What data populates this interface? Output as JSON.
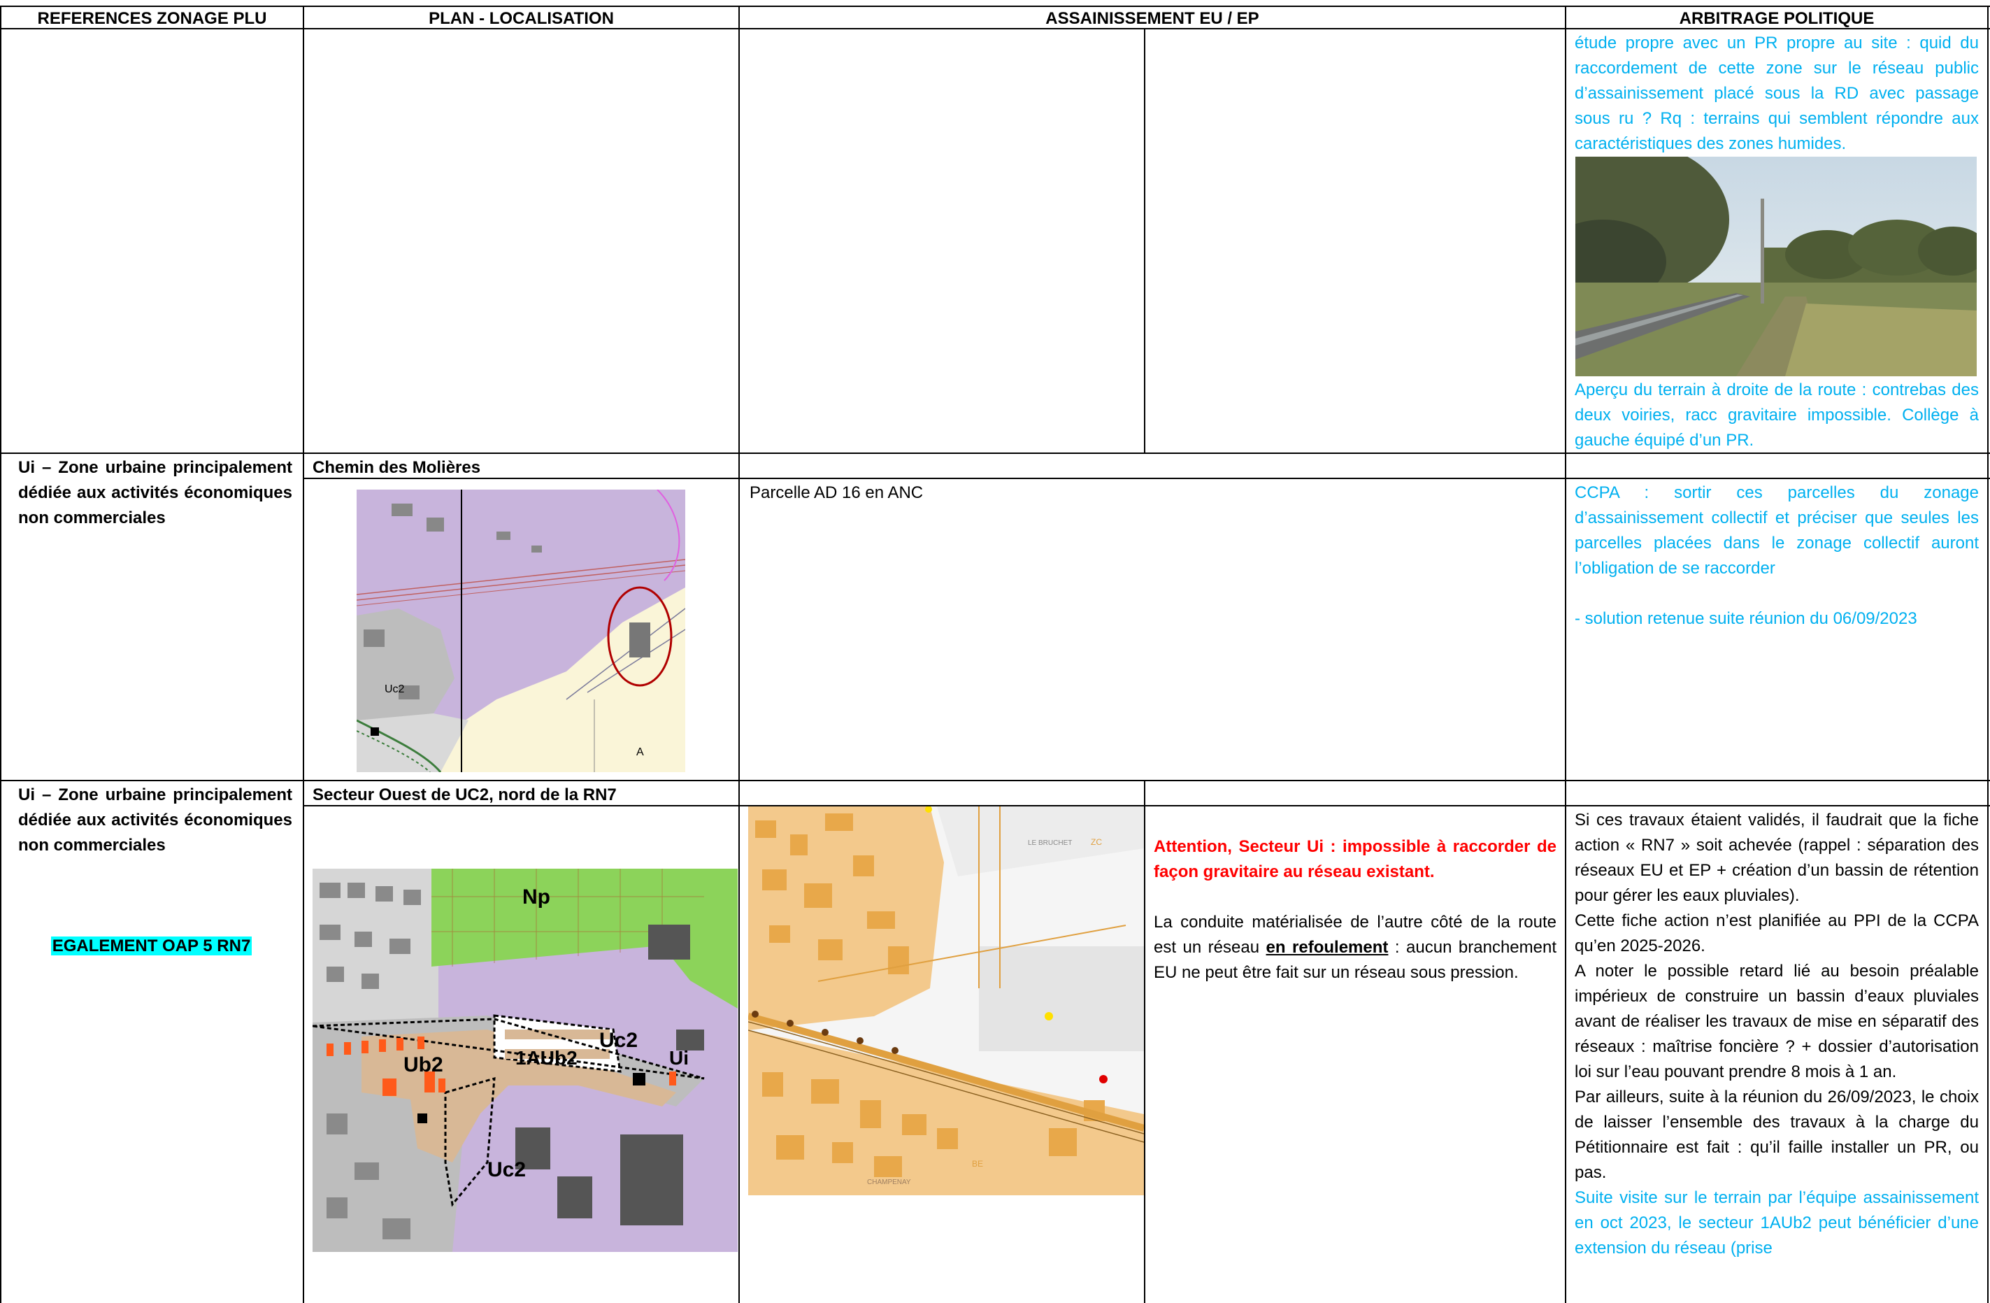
{
  "headers": {
    "col1": "REFERENCES ZONAGE PLU",
    "col2": "PLAN - LOCALISATION",
    "col3": "ASSAINISSEMENT EU / EP",
    "col4": "ARBITRAGE POLITIQUE"
  },
  "row0": {
    "arbitrage_top": "étude propre avec un PR propre au site : quid du raccordement de cette zone sur le réseau public d’assainissement placé sous la RD avec passage sous ru ? Rq : terrains qui semblent répondre aux caractéristiques des zones humides.",
    "photo_caption": "Aperçu du terrain à droite de la route : contrebas des deux voiries, racc gravitaire impossible. Collège à gauche équipé d’un PR."
  },
  "row1": {
    "zonage": "Ui – Zone urbaine principalement dédiée aux activités économiques non commerciales",
    "location_title": "Chemin des Molières",
    "assainissement": "Parcelle AD 16 en ANC",
    "arbitrage_1": "CCPA : sortir ces parcelles du zonage d’assainissement collectif et préciser que seules les parcelles placées dans le zonage collectif auront l’obligation de se raccorder",
    "arbitrage_2": "- solution retenue suite réunion du 06/09/2023",
    "map_labels": {
      "uc2": "Uc2",
      "a": "A"
    }
  },
  "row2": {
    "zonage": "Ui – Zone urbaine principalement dédiée aux activités économiques non commerciales",
    "oap_badge": "EGALEMENT OAP 5 RN7",
    "location_title": "Secteur Ouest de UC2, nord de la RN7",
    "attention": "Attention, Secteur Ui : impossible à raccorder de façon gravitaire au réseau existant.",
    "conduite_before": "La conduite matérialisée de l’autre côté de la route est un réseau ",
    "conduite_bold": "en refoulement",
    "conduite_after": " : aucun branchement EU ne peut être fait sur un réseau sous pression.",
    "arb_p1": "Si ces travaux étaient validés, il faudrait que la fiche action « RN7 » soit achevée (rappel : séparation des réseaux EU et EP + création d’un bassin de rétention pour gérer les eaux pluviales).",
    "arb_p2": "Cette fiche action n’est planifiée au PPI de la CCPA qu’en 2025-2026.",
    "arb_p3": "A noter le possible retard lié au besoin préalable impérieux de construire un bassin d’eaux pluviales avant de réaliser les travaux de mise en séparatif des réseaux : maîtrise foncière ? + dossier d’autorisation loi sur l’eau pouvant prendre 8 mois à 1 an.",
    "arb_p4": "Par ailleurs, suite à la réunion du 26/09/2023, le choix de laisser l’ensemble des travaux à la charge du Pétitionnaire est fait : qu’il faille installer un PR, ou pas.",
    "arb_p5": "Suite visite sur le terrain par l’équipe assainissement en oct 2023, le secteur 1AUb2 peut bénéficier d’une extension du réseau (prise",
    "map_labels": {
      "np": "Np",
      "uc2a": "Uc2",
      "ub2": "Ub2",
      "aub2": "1AUb2",
      "ui": "Ui",
      "uc2b": "Uc2"
    },
    "network_labels": {
      "bruchet": "LE BRUCHET",
      "zc": "ZC",
      "champenay": "CHAMPENAY",
      "be": "BE"
    }
  }
}
